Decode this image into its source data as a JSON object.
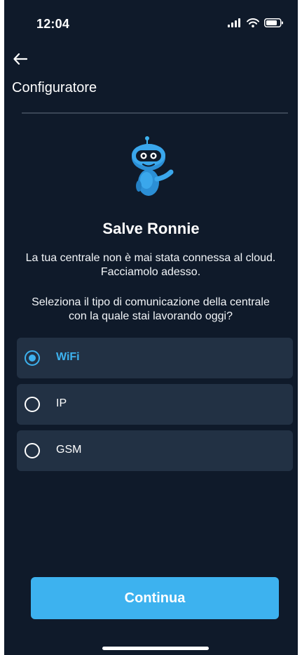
{
  "status_bar": {
    "time": "12:04",
    "icons": [
      "cellular-signal-icon",
      "wifi-icon",
      "battery-icon"
    ]
  },
  "header": {
    "back_icon": "arrow-left-icon",
    "title": "Configuratore"
  },
  "mascot_icon": "robot-mascot-icon",
  "greeting": "Salve Ronnie",
  "intro_text": "La tua centrale non è mai stata connessa al cloud. Facciamolo adesso.",
  "question_text": "Seleziona il tipo di comunicazione della centrale con la quale stai lavorando oggi?",
  "options": [
    {
      "label": "WiFi",
      "selected": true
    },
    {
      "label": "IP",
      "selected": false
    },
    {
      "label": "GSM",
      "selected": false
    }
  ],
  "continue_label": "Continua",
  "colors": {
    "background": "#0f1a2a",
    "card": "#223144",
    "accent": "#3db2ef",
    "divider": "#3a4656",
    "text": "#ffffff"
  }
}
